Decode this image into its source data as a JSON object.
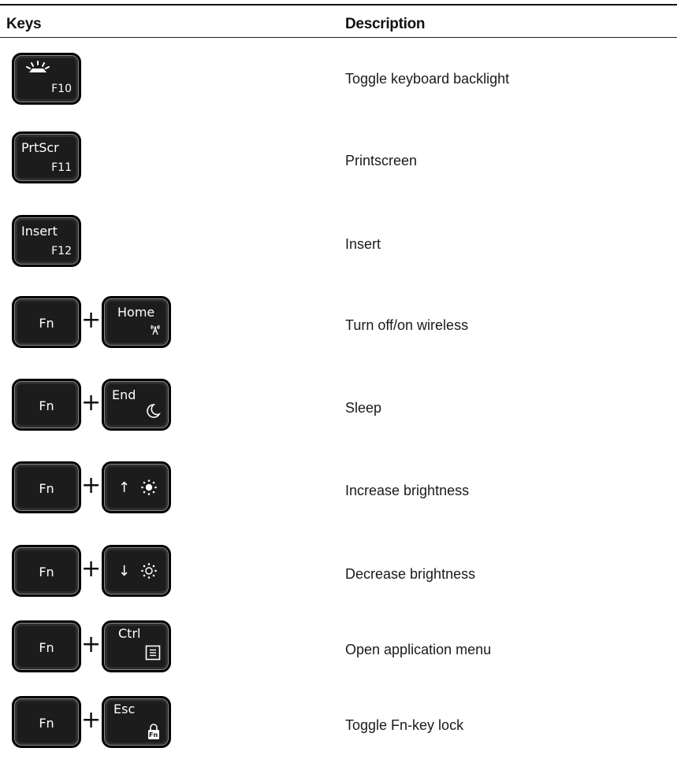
{
  "header": {
    "keys_label": "Keys",
    "description_label": "Description"
  },
  "rows": [
    {
      "key_bottom": "F10",
      "description": "Toggle keyboard backlight"
    },
    {
      "key_top": "PrtScr",
      "key_bottom": "F11",
      "description": "Printscreen"
    },
    {
      "key_top": "Insert",
      "key_bottom": "F12",
      "description": "Insert"
    },
    {
      "fn": "Fn",
      "plus": "+",
      "key_top": "Home",
      "description": "Turn off/on wireless"
    },
    {
      "fn": "Fn",
      "plus": "+",
      "key_top": "End",
      "description": "Sleep"
    },
    {
      "fn": "Fn",
      "plus": "+",
      "key_top": "↑",
      "description": "Increase brightness"
    },
    {
      "fn": "Fn",
      "plus": "+",
      "key_top": "↓",
      "description": "Decrease brightness"
    },
    {
      "fn": "Fn",
      "plus": "+",
      "key_top": "Ctrl",
      "description": "Open application menu"
    },
    {
      "fn": "Fn",
      "plus": "+",
      "key_top": "Esc",
      "key_sub": "Fn",
      "description": "Toggle Fn-key lock"
    }
  ],
  "icons": {
    "row0": "keyboard-backlight-icon",
    "row3": "wireless-icon",
    "row4": "moon-icon",
    "row5": "brightness-up-icon",
    "row6": "brightness-down-icon",
    "row7": "menu-icon",
    "row8": "fn-lock-icon"
  }
}
